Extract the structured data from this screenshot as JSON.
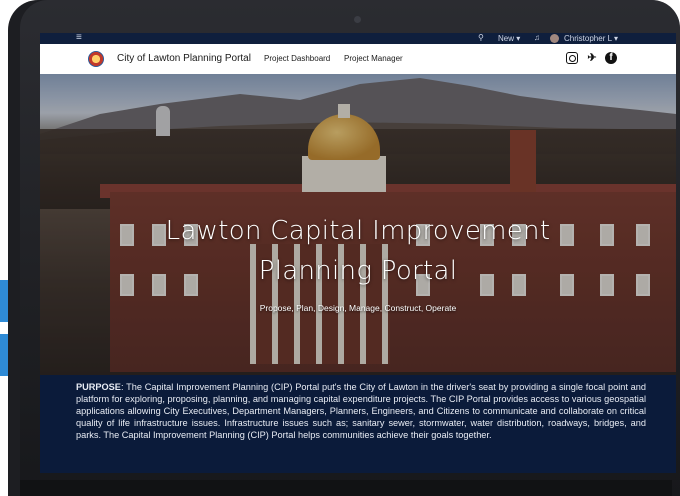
{
  "topbar": {
    "new_label": "New",
    "user_name": "Christopher L"
  },
  "navbar": {
    "portal_name": "City of Lawton Planning Portal",
    "links": [
      "Project Dashboard",
      "Project Manager"
    ]
  },
  "hero": {
    "title_line1": "Lawton Capital Improvement",
    "title_line2": "Planning Portal",
    "subtitle": "Propose, Plan, Design, Manage, Construct, Operate"
  },
  "purpose": {
    "label": "PURPOSE",
    "text": ": The Capital Improvement Planning (CIP) Portal put's the City of Lawton in the driver's seat by providing a single focal point and platform for exploring, proposing, planning, and managing capital expenditure projects. The CIP Portal provides access to various geospatial applications allowing City Executives, Department Managers, Planners, Engineers, and Citizens to communicate and collaborate on critical quality of life infrastructure issues. Infrastructure issues such as; sanitary sewer, stormwater, water distribution, roadways, bridges, and parks. The Capital Improvement Planning (CIP) Portal helps communities achieve their goals together."
  },
  "icons": {
    "menu": "menu-icon",
    "search": "search-icon",
    "notifications": "bell-icon",
    "instagram": "instagram-icon",
    "twitter": "twitter-icon",
    "facebook": "facebook-icon"
  },
  "colors": {
    "accent_blue": "#2f8bd6",
    "purpose_bg": "#0b1b3a",
    "topbar_bg": "#0f1f3d"
  }
}
